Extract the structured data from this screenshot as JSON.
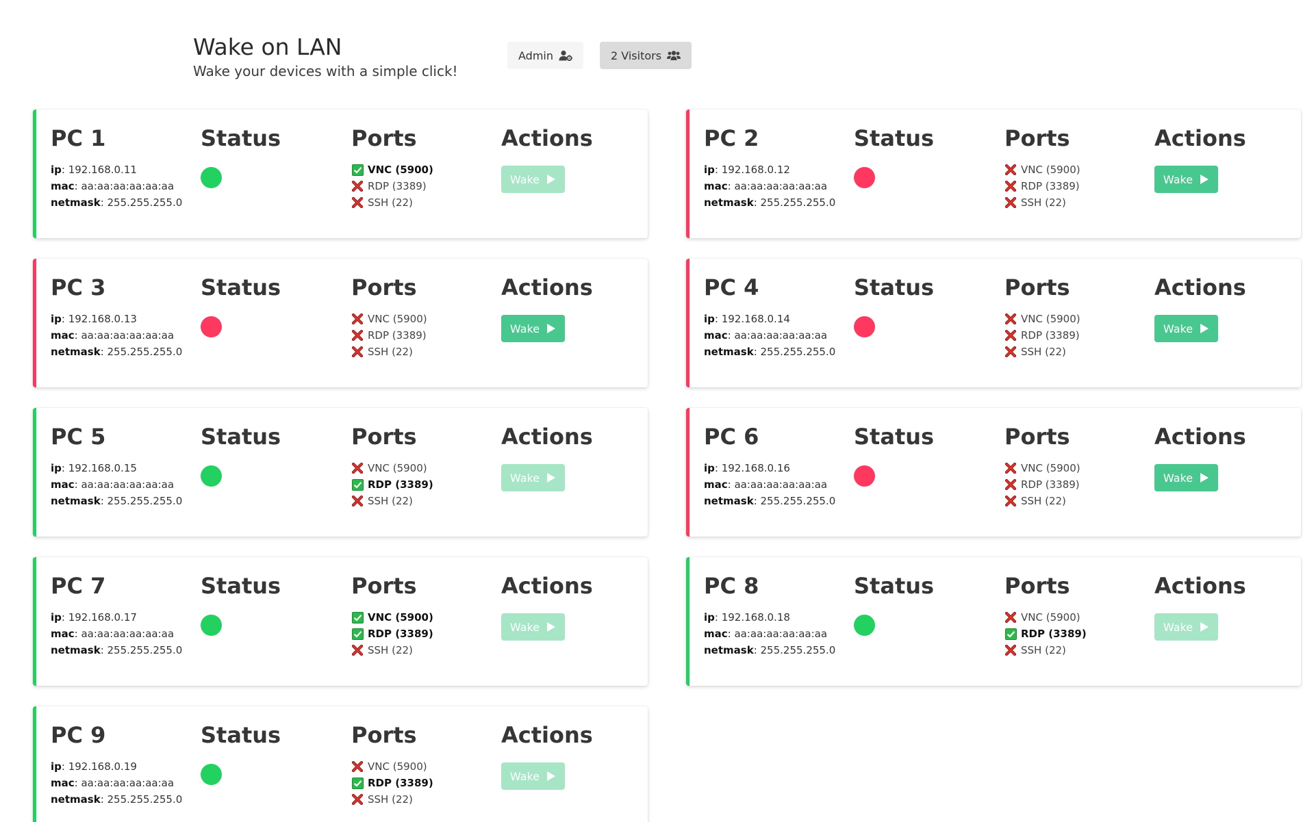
{
  "header": {
    "title": "Wake on LAN",
    "subtitle": "Wake your devices with a simple click!",
    "admin_label": "Admin",
    "visitors_label": "2 Visitors"
  },
  "columns": {
    "status": "Status",
    "ports": "Ports",
    "actions": "Actions"
  },
  "labels": {
    "ip": "ip",
    "mac": "mac",
    "netmask": "netmask",
    "wake": "Wake"
  },
  "colors": {
    "online": "#23d160",
    "offline": "#ff3860",
    "wake_button": "#48c78e",
    "wake_button_disabled": "#a6e6c7"
  },
  "devices": [
    {
      "name": "PC 1",
      "ip": "192.168.0.11",
      "mac": "aa:aa:aa:aa:aa:aa",
      "netmask": "255.255.255.0",
      "online": true,
      "ports": [
        {
          "label": "VNC (5900)",
          "open": true
        },
        {
          "label": "RDP (3389)",
          "open": false
        },
        {
          "label": "SSH (22)",
          "open": false
        }
      ]
    },
    {
      "name": "PC 2",
      "ip": "192.168.0.12",
      "mac": "aa:aa:aa:aa:aa:aa",
      "netmask": "255.255.255.0",
      "online": false,
      "ports": [
        {
          "label": "VNC (5900)",
          "open": false
        },
        {
          "label": "RDP (3389)",
          "open": false
        },
        {
          "label": "SSH (22)",
          "open": false
        }
      ]
    },
    {
      "name": "PC 3",
      "ip": "192.168.0.13",
      "mac": "aa:aa:aa:aa:aa:aa",
      "netmask": "255.255.255.0",
      "online": false,
      "ports": [
        {
          "label": "VNC (5900)",
          "open": false
        },
        {
          "label": "RDP (3389)",
          "open": false
        },
        {
          "label": "SSH (22)",
          "open": false
        }
      ]
    },
    {
      "name": "PC 4",
      "ip": "192.168.0.14",
      "mac": "aa:aa:aa:aa:aa:aa",
      "netmask": "255.255.255.0",
      "online": false,
      "ports": [
        {
          "label": "VNC (5900)",
          "open": false
        },
        {
          "label": "RDP (3389)",
          "open": false
        },
        {
          "label": "SSH (22)",
          "open": false
        }
      ]
    },
    {
      "name": "PC 5",
      "ip": "192.168.0.15",
      "mac": "aa:aa:aa:aa:aa:aa",
      "netmask": "255.255.255.0",
      "online": true,
      "ports": [
        {
          "label": "VNC (5900)",
          "open": false
        },
        {
          "label": "RDP (3389)",
          "open": true
        },
        {
          "label": "SSH (22)",
          "open": false
        }
      ]
    },
    {
      "name": "PC 6",
      "ip": "192.168.0.16",
      "mac": "aa:aa:aa:aa:aa:aa",
      "netmask": "255.255.255.0",
      "online": false,
      "ports": [
        {
          "label": "VNC (5900)",
          "open": false
        },
        {
          "label": "RDP (3389)",
          "open": false
        },
        {
          "label": "SSH (22)",
          "open": false
        }
      ]
    },
    {
      "name": "PC 7",
      "ip": "192.168.0.17",
      "mac": "aa:aa:aa:aa:aa:aa",
      "netmask": "255.255.255.0",
      "online": true,
      "ports": [
        {
          "label": "VNC (5900)",
          "open": true
        },
        {
          "label": "RDP (3389)",
          "open": true
        },
        {
          "label": "SSH (22)",
          "open": false
        }
      ]
    },
    {
      "name": "PC 8",
      "ip": "192.168.0.18",
      "mac": "aa:aa:aa:aa:aa:aa",
      "netmask": "255.255.255.0",
      "online": true,
      "ports": [
        {
          "label": "VNC (5900)",
          "open": false
        },
        {
          "label": "RDP (3389)",
          "open": true
        },
        {
          "label": "SSH (22)",
          "open": false
        }
      ]
    },
    {
      "name": "PC 9",
      "ip": "192.168.0.19",
      "mac": "aa:aa:aa:aa:aa:aa",
      "netmask": "255.255.255.0",
      "online": true,
      "ports": [
        {
          "label": "VNC (5900)",
          "open": false
        },
        {
          "label": "RDP (3389)",
          "open": true
        },
        {
          "label": "SSH (22)",
          "open": false
        }
      ]
    }
  ]
}
